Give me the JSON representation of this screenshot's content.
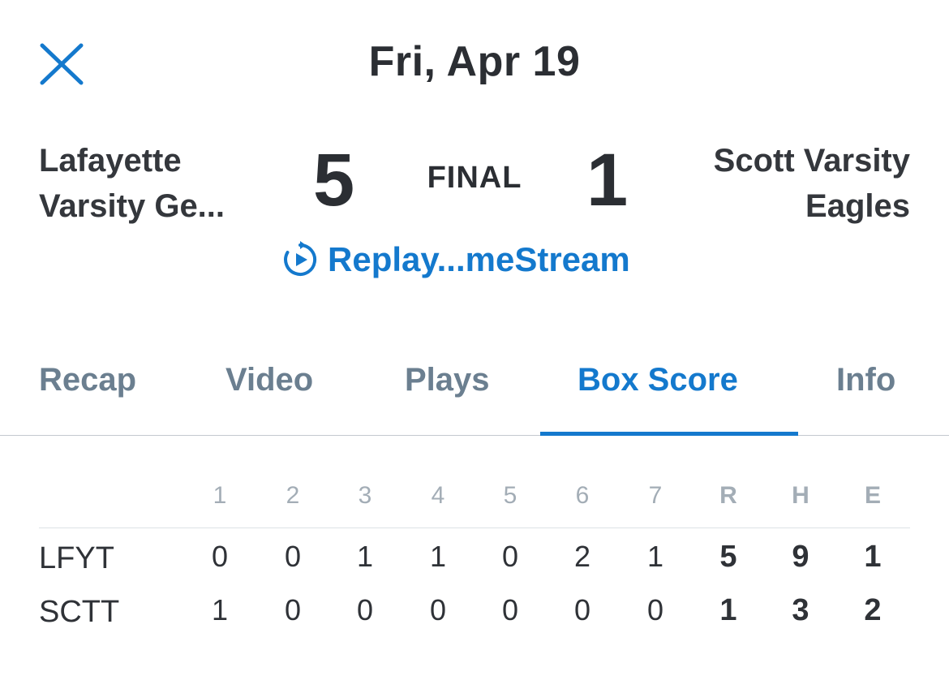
{
  "header": {
    "date": "Fri, Apr 19",
    "close_icon": "close-icon"
  },
  "game": {
    "home": {
      "line1": "Lafayette",
      "line2": "Varsity Ge...",
      "score": "5"
    },
    "away": {
      "line1": "Scott Varsity",
      "line2": "Eagles",
      "score": "1"
    },
    "status": "FINAL",
    "replay_label": "Replay...meStream",
    "replay_icon": "replay-icon"
  },
  "tabs": [
    {
      "label": "Recap",
      "active": false
    },
    {
      "label": "Video",
      "active": false
    },
    {
      "label": "Plays",
      "active": false
    },
    {
      "label": "Box Score",
      "active": true
    },
    {
      "label": "Info",
      "active": false
    }
  ],
  "box_score": {
    "headers": [
      "1",
      "2",
      "3",
      "4",
      "5",
      "6",
      "7",
      "R",
      "H",
      "E"
    ],
    "rows": [
      {
        "team": "LFYT",
        "cells": [
          "0",
          "0",
          "1",
          "1",
          "0",
          "2",
          "1",
          "5",
          "9",
          "1"
        ]
      },
      {
        "team": "SCTT",
        "cells": [
          "1",
          "0",
          "0",
          "0",
          "0",
          "0",
          "0",
          "1",
          "3",
          "2"
        ]
      }
    ]
  },
  "colors": {
    "accent": "#1479cd",
    "text": "#2b2e33",
    "tab_inactive": "#6b7f90",
    "header_muted": "#a3adb6"
  }
}
